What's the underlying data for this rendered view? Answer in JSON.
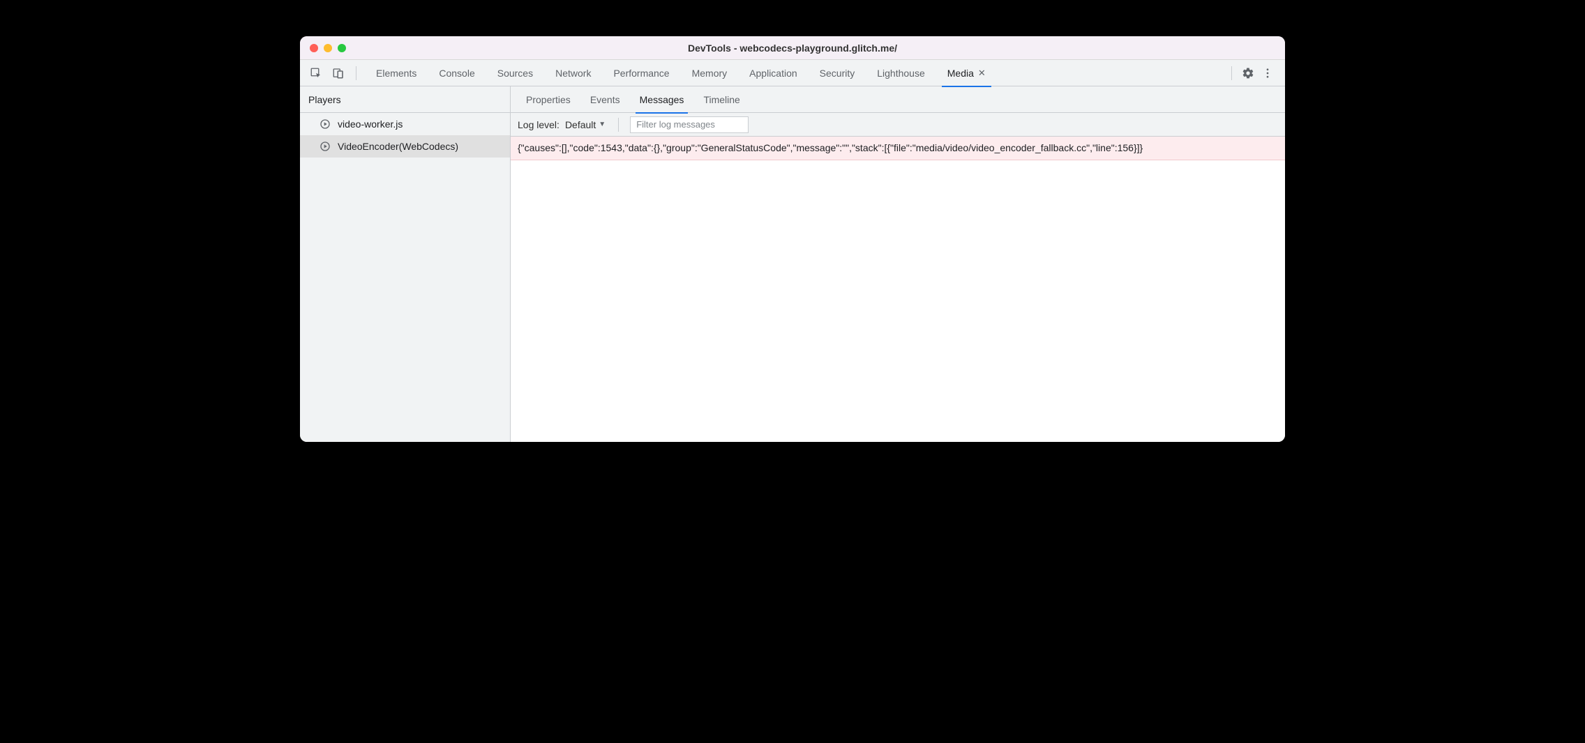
{
  "window": {
    "title": "DevTools - webcodecs-playground.glitch.me/"
  },
  "main_tabs": {
    "items": [
      {
        "label": "Elements"
      },
      {
        "label": "Console"
      },
      {
        "label": "Sources"
      },
      {
        "label": "Network"
      },
      {
        "label": "Performance"
      },
      {
        "label": "Memory"
      },
      {
        "label": "Application"
      },
      {
        "label": "Security"
      },
      {
        "label": "Lighthouse"
      },
      {
        "label": "Media"
      }
    ],
    "active_index": 9
  },
  "sidebar": {
    "header": "Players",
    "items": [
      {
        "label": "video-worker.js"
      },
      {
        "label": "VideoEncoder(WebCodecs)"
      }
    ],
    "selected_index": 1
  },
  "sub_tabs": {
    "items": [
      {
        "label": "Properties"
      },
      {
        "label": "Events"
      },
      {
        "label": "Messages"
      },
      {
        "label": "Timeline"
      }
    ],
    "active_index": 2
  },
  "toolbar": {
    "log_level_label": "Log level:",
    "log_level_value": "Default",
    "filter_placeholder": "Filter log messages"
  },
  "messages": [
    {
      "text": "{\"causes\":[],\"code\":1543,\"data\":{},\"group\":\"GeneralStatusCode\",\"message\":\"\",\"stack\":[{\"file\":\"media/video/video_encoder_fallback.cc\",\"line\":156}]}"
    }
  ]
}
